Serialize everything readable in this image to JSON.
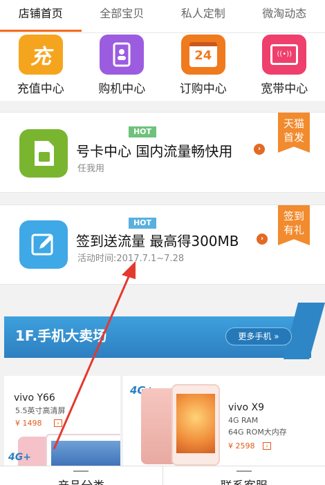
{
  "tabs": [
    "店铺首页",
    "全部宝贝",
    "私人定制",
    "微淘动态"
  ],
  "quick_items": [
    {
      "label": "充值中心",
      "icon": "recharge-icon",
      "color": "#f5a51d",
      "glyph": "充"
    },
    {
      "label": "购机中心",
      "icon": "phone-icon",
      "color": "#9c5ce0",
      "glyph": ""
    },
    {
      "label": "订购中心",
      "icon": "calendar-icon",
      "color": "#f07a1e",
      "glyph": "24"
    },
    {
      "label": "宽带中心",
      "icon": "router-icon",
      "color": "#ef3f6d",
      "glyph": "((•))"
    }
  ],
  "promo1": {
    "hot": "HOT",
    "title": "号卡中心  国内流量畅快用",
    "subtitle": "任我用",
    "ribbon": [
      "天猫",
      "首发"
    ],
    "icon": "sim-card-icon",
    "color": "#7ab530"
  },
  "promo2": {
    "hot": "HOT",
    "title": "签到送流量 最高得300MB",
    "subtitle": "活动时间:2017.7.1~7.28",
    "ribbon": [
      "签到",
      "有礼"
    ],
    "icon": "edit-icon",
    "color": "#3fa8e6"
  },
  "floor": {
    "title": "1F.手机大卖场",
    "more": "更多手机 »"
  },
  "products": [
    {
      "name": "vivo Y66",
      "desc": [
        "5.5英寸高清屏"
      ],
      "price": "¥ 1498"
    },
    {
      "name": "vivo X9",
      "desc": [
        "4G RAM",
        "64G ROM大内存"
      ],
      "price": "¥ 2598"
    }
  ],
  "badge_4g": "4G+",
  "bottom_tabs": [
    "产品分类",
    "联系客服"
  ]
}
